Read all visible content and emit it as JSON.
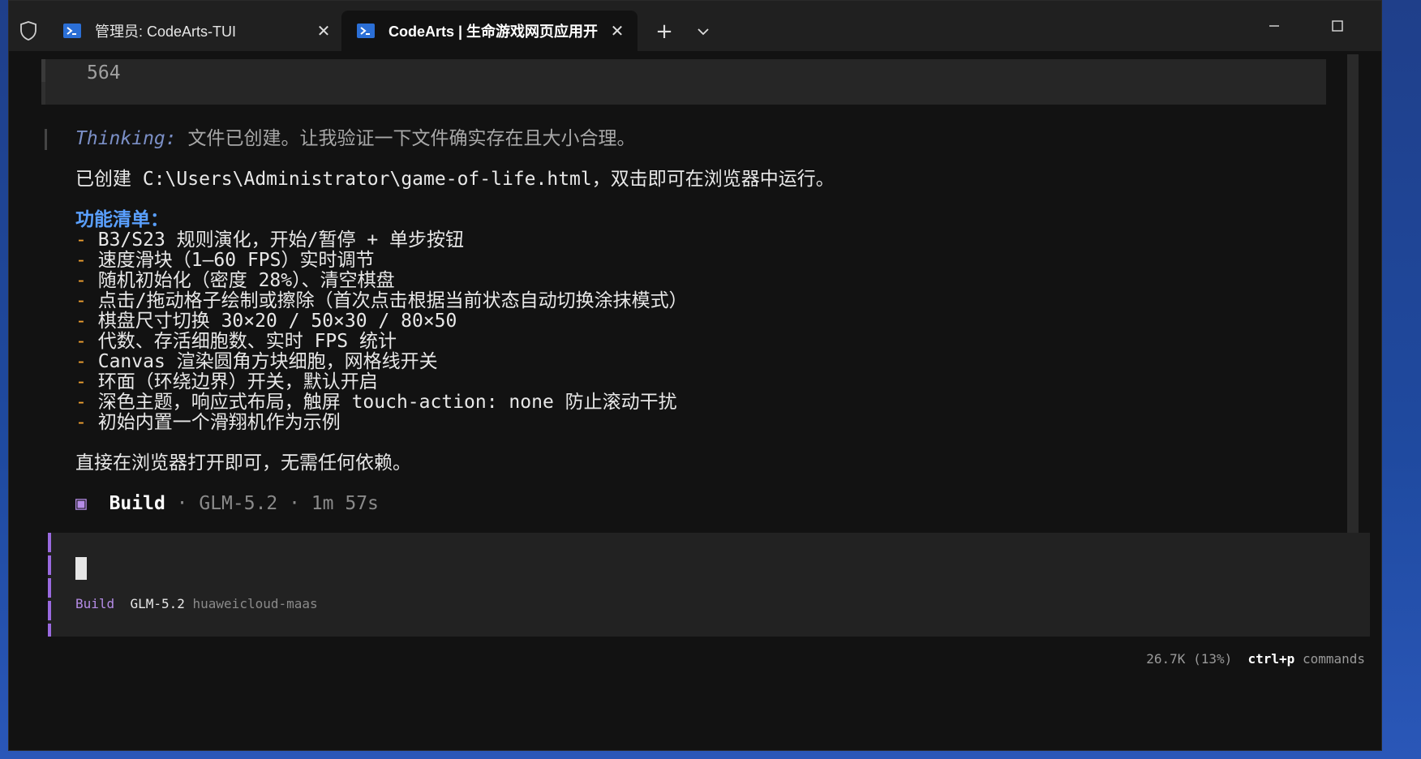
{
  "window": {
    "tabs": [
      {
        "title": "管理员: CodeArts-TUI",
        "active": false
      },
      {
        "title": "CodeArts | 生命游戏网页应用开",
        "active": true
      }
    ],
    "new_tab_label": "+",
    "close_glyph": "✕"
  },
  "terminal": {
    "prev_output": "564",
    "thinking_label": "Thinking:",
    "thinking_text": " 文件已创建。让我验证一下文件确实存在且大小合理。",
    "created_line": "已创建 C:\\Users\\Administrator\\game-of-life.html，双击即可在浏览器中运行。",
    "features_heading": "功能清单：",
    "features": [
      "B3/S23 规则演化，开始/暂停 + 单步按钮",
      "速度滑块（1–60 FPS）实时调节",
      "随机初始化（密度 28%）、清空棋盘",
      "点击/拖动格子绘制或擦除（首次点击根据当前状态自动切换涂抹模式）",
      "棋盘尺寸切换 30×20 / 50×30 / 80×50",
      "代数、存活细胞数、实时 FPS 统计",
      "Canvas 渲染圆角方块细胞，网格线开关",
      "环面（环绕边界）开关，默认开启",
      "深色主题，响应式布局，触屏 touch-action: none 防止滚动干扰",
      "初始内置一个滑翔机作为示例"
    ],
    "dash": "-",
    "closing_line": "直接在浏览器打开即可，无需任何依赖。",
    "build_status": {
      "icon": "▣",
      "label": "Build",
      "detail": " · GLM-5.2 · 1m 57s"
    }
  },
  "input": {
    "agent": "Build",
    "model": "GLM-5.2",
    "provider": "huaweicloud-maas"
  },
  "footer": {
    "tokens": "26.7K (13%)",
    "shortcut": "ctrl+p",
    "commands_label": "commands"
  },
  "colors": {
    "accent_purple": "#b58ce6",
    "heading_blue": "#5aa0ff",
    "bullet_orange": "#f0a030",
    "thinking_blue": "#7b8fc6"
  }
}
